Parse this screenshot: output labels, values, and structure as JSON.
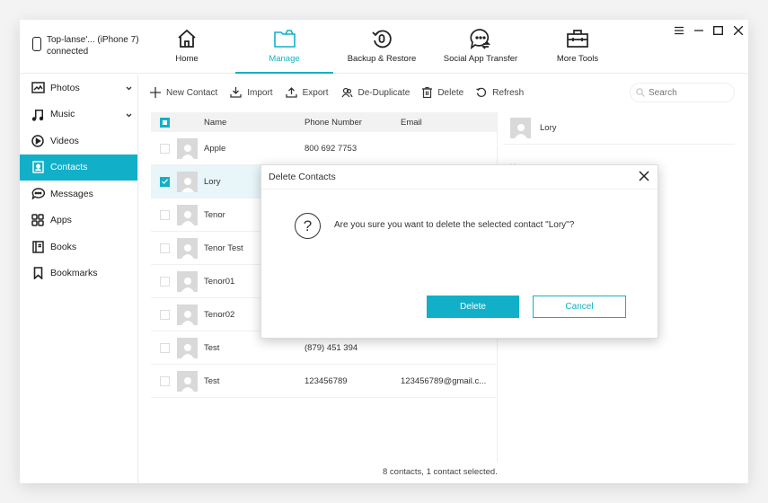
{
  "device": {
    "name": "Top-lanse'... (iPhone 7)",
    "status": "connected"
  },
  "nav": [
    {
      "label": "Home",
      "icon": "home-icon"
    },
    {
      "label": "Manage",
      "icon": "folder-icon",
      "active": true
    },
    {
      "label": "Backup & Restore",
      "icon": "backup-restore-icon"
    },
    {
      "label": "Social App Transfer",
      "icon": "chat-transfer-icon"
    },
    {
      "label": "More Tools",
      "icon": "toolbox-icon"
    }
  ],
  "window_controls": [
    "menu-icon",
    "minimize-icon",
    "maximize-icon",
    "close-icon"
  ],
  "sidebar": {
    "items": [
      {
        "label": "Photos",
        "icon": "photo-icon",
        "expandable": true
      },
      {
        "label": "Music",
        "icon": "music-icon",
        "expandable": true
      },
      {
        "label": "Videos",
        "icon": "video-icon"
      },
      {
        "label": "Contacts",
        "icon": "contact-icon",
        "active": true
      },
      {
        "label": "Messages",
        "icon": "message-icon"
      },
      {
        "label": "Apps",
        "icon": "apps-icon"
      },
      {
        "label": "Books",
        "icon": "book-icon"
      },
      {
        "label": "Bookmarks",
        "icon": "bookmark-icon"
      }
    ]
  },
  "toolbar": {
    "new_contact": "New Contact",
    "import": "Import",
    "export": "Export",
    "deduplicate": "De-Duplicate",
    "delete": "Delete",
    "refresh": "Refresh"
  },
  "search": {
    "placeholder": "Search"
  },
  "table": {
    "headers": {
      "name": "Name",
      "phone": "Phone Number",
      "email": "Email"
    },
    "rows": [
      {
        "name": "Apple",
        "phone": "800 692 7753",
        "email": "",
        "selected": false
      },
      {
        "name": "Lory",
        "phone": "",
        "email": "",
        "selected": true
      },
      {
        "name": "Tenor",
        "phone": "",
        "email": "",
        "selected": false
      },
      {
        "name": "Tenor Test",
        "phone": "",
        "email": "",
        "selected": false
      },
      {
        "name": "Tenor01",
        "phone": "",
        "email": "",
        "selected": false
      },
      {
        "name": "Tenor02",
        "phone": "",
        "email": "",
        "selected": false
      },
      {
        "name": "Test",
        "phone": "(879) 451 394",
        "email": "",
        "selected": false
      },
      {
        "name": "Test",
        "phone": "123456789",
        "email": "123456789@gmail.c...",
        "selected": false
      }
    ]
  },
  "detail": {
    "name": "Lory",
    "field_label": "Home"
  },
  "status_text": "8 contacts, 1 contact selected.",
  "dialog": {
    "title": "Delete Contacts",
    "message": "Are you sure you want to delete the selected contact \"Lory\"?",
    "confirm": "Delete",
    "cancel": "Cancel"
  },
  "colors": {
    "accent": "#12b0c8",
    "selected_row": "#e8f6f9"
  }
}
